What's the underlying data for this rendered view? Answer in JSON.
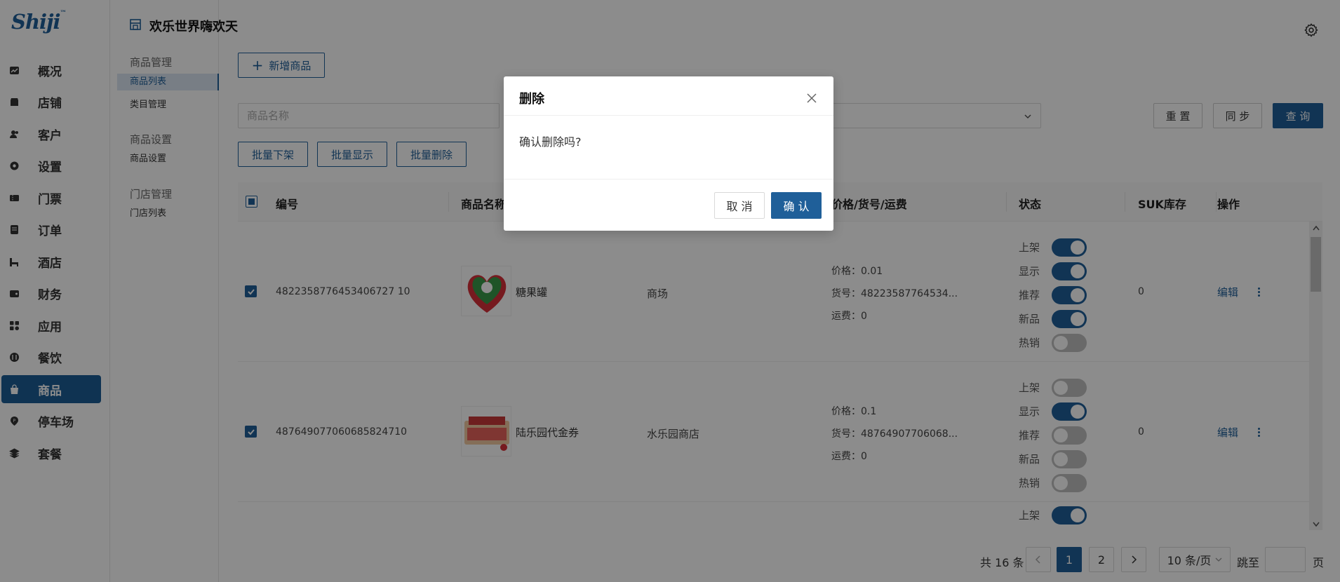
{
  "app": {
    "logo": "Shiji",
    "logo_mark": "™",
    "store_title": "欢乐世界嗨欢天"
  },
  "sidebar": {
    "items": [
      {
        "label": "概况",
        "icon": "chart-icon"
      },
      {
        "label": "店铺",
        "icon": "store-icon"
      },
      {
        "label": "客户",
        "icon": "users-icon"
      },
      {
        "label": "设置",
        "icon": "settings-icon"
      },
      {
        "label": "门票",
        "icon": "ticket-icon"
      },
      {
        "label": "订单",
        "icon": "order-icon"
      },
      {
        "label": "酒店",
        "icon": "hotel-icon"
      },
      {
        "label": "财务",
        "icon": "wallet-icon"
      },
      {
        "label": "应用",
        "icon": "apps-icon"
      },
      {
        "label": "餐饮",
        "icon": "food-icon"
      },
      {
        "label": "商品",
        "icon": "bag-icon",
        "active": true
      },
      {
        "label": "停车场",
        "icon": "parking-icon"
      },
      {
        "label": "套餐",
        "icon": "package-icon"
      }
    ]
  },
  "submenu": {
    "groups": [
      {
        "title": "商品管理",
        "items": [
          "商品列表",
          "类目管理"
        ]
      },
      {
        "title": "商品设置",
        "items": [
          "商品设置"
        ]
      },
      {
        "title": "门店管理",
        "items": [
          "门店列表"
        ]
      }
    ],
    "active_item": "商品列表"
  },
  "toolbar": {
    "add_label": "新增商品",
    "name_placeholder": "商品名称",
    "reset_label": "重 置",
    "sync_label": "同 步",
    "query_label": "查 询",
    "batch_off_label": "批量下架",
    "batch_show_label": "批量显示",
    "batch_delete_label": "批量删除"
  },
  "table": {
    "columns": [
      "编号",
      "商品名称",
      "价格/货号/运费",
      "状态",
      "SUK库存",
      "操作"
    ],
    "rows": [
      {
        "checked": true,
        "id": "4822358776453406727 10",
        "name": "糖果罐",
        "store": "商场",
        "price": "价格：0.01",
        "sku": "货号：48223587764534...",
        "freight": "运费：0",
        "stock": "0",
        "edit": "编辑",
        "toggles": [
          {
            "label": "上架",
            "on": true
          },
          {
            "label": "显示",
            "on": true
          },
          {
            "label": "推荐",
            "on": true
          },
          {
            "label": "新品",
            "on": true
          },
          {
            "label": "热销",
            "on": false
          }
        ]
      },
      {
        "checked": true,
        "id": "487649077060685824710",
        "name": "陆乐园代金券",
        "store": "水乐园商店",
        "price": "价格：0.1",
        "sku": "货号：48764907706068...",
        "freight": "运费：0",
        "stock": "0",
        "edit": "编辑",
        "toggles": [
          {
            "label": "上架",
            "on": false
          },
          {
            "label": "显示",
            "on": true
          },
          {
            "label": "推荐",
            "on": false
          },
          {
            "label": "新品",
            "on": false
          },
          {
            "label": "热销",
            "on": false
          }
        ]
      },
      {
        "toggles": [
          {
            "label": "上架",
            "on": true
          }
        ]
      }
    ]
  },
  "pagination": {
    "total": "共 16 条",
    "pages": [
      "1",
      "2"
    ],
    "current": "1",
    "per_page": "10 条/页",
    "jump_label": "跳至",
    "page_suffix": "页"
  },
  "modal": {
    "title": "删除",
    "message": "确认删除吗?",
    "cancel_label": "取 消",
    "ok_label": "确 认"
  },
  "colors": {
    "primary": "#1f5f99",
    "toggle_off": "#bfbfbf",
    "overlay": "rgba(0,0,0,0.45)"
  }
}
